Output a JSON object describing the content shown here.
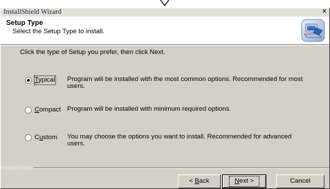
{
  "window": {
    "title": "InstallShield Wizard",
    "close_glyph": "✕"
  },
  "header": {
    "title": "Setup Type",
    "subtitle": "Select the Setup Type to install.",
    "icon": "computer-install-icon"
  },
  "instruction": "Click the type of Setup you prefer, then click Next.",
  "options": [
    {
      "label_mnemonic": "T",
      "label_rest": "ypical",
      "selected": true,
      "description": "Program will be installed with the most common options.  Recommended for most users."
    },
    {
      "label_mnemonic": "C",
      "label_rest": "ompact",
      "selected": false,
      "description": "Program will be installed with minimum required options."
    },
    {
      "label_mnemonic_prefix": "C",
      "label_mnemonic": "u",
      "label_rest": "stom",
      "selected": false,
      "description": "You may choose the options you want to install. Recommended for advanced users."
    }
  ],
  "footer": {
    "brand": "InstallShield"
  },
  "buttons": {
    "back_prefix": "< ",
    "back_mnemonic": "B",
    "back_rest": "ack",
    "next_mnemonic": "N",
    "next_rest": "ext >",
    "cancel": "Cancel"
  },
  "colors": {
    "dialog_face": "#d4d0c8",
    "header_bg": "#ffffff",
    "titlebar_bg": "#e3e1dc"
  }
}
